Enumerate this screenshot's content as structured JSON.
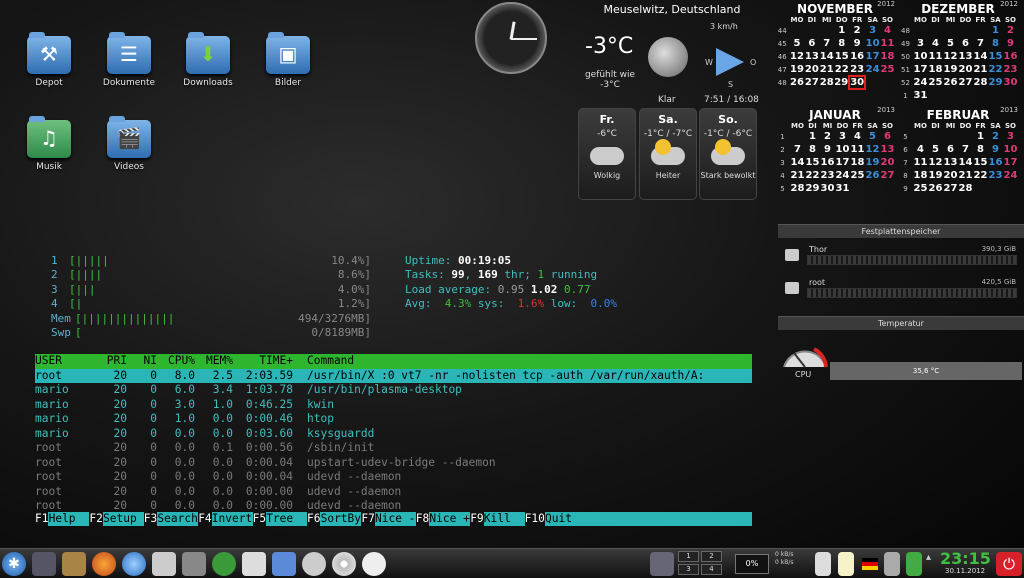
{
  "desktop": {
    "icons": [
      {
        "label": "Depot",
        "icon": "toolbox-folder-icon"
      },
      {
        "label": "Dokumente",
        "icon": "documents-folder-icon"
      },
      {
        "label": "Downloads",
        "icon": "downloads-folder-icon"
      },
      {
        "label": "Bilder",
        "icon": "pictures-folder-icon"
      },
      {
        "label": "Musik",
        "icon": "music-folder-icon"
      },
      {
        "label": "Videos",
        "icon": "videos-folder-icon"
      }
    ]
  },
  "weather": {
    "city": "Meuselwitz, Deutschland",
    "temperature": "-3°C",
    "feels_like_label": "gefühlt wie",
    "feels_like": "-3°C",
    "condition": "Klar",
    "wind_speed": "3 km/h",
    "wind_dirs": [
      "W",
      "O",
      "S"
    ],
    "sun_times": "7:51 / 16:08",
    "forecast": [
      {
        "day": "Fr.",
        "temps": "-6°C",
        "cond": "Wolkig"
      },
      {
        "day": "Sa.",
        "temps": "-1°C / -7°C",
        "cond": "Heiter"
      },
      {
        "day": "So.",
        "temps": "-1°C / -6°C",
        "cond": "Stark bewolkt"
      }
    ]
  },
  "calendars": {
    "weekday_headers": [
      "MO",
      "DI",
      "MI",
      "DO",
      "FR",
      "SA",
      "SO"
    ],
    "months": [
      {
        "name": "NOVEMBER",
        "year": "2012",
        "weeks": [
          {
            "wk": "44",
            "days": [
              "",
              "",
              "",
              "1",
              "2",
              "3",
              "4"
            ]
          },
          {
            "wk": "45",
            "days": [
              "5",
              "6",
              "7",
              "8",
              "9",
              "10",
              "11"
            ]
          },
          {
            "wk": "46",
            "days": [
              "12",
              "13",
              "14",
              "15",
              "16",
              "17",
              "18"
            ]
          },
          {
            "wk": "47",
            "days": [
              "19",
              "20",
              "21",
              "22",
              "23",
              "24",
              "25"
            ]
          },
          {
            "wk": "48",
            "days": [
              "26",
              "27",
              "28",
              "29",
              "30",
              "",
              ""
            ]
          }
        ]
      },
      {
        "name": "DEZEMBER",
        "year": "2012",
        "weeks": [
          {
            "wk": "48",
            "days": [
              "",
              "",
              "",
              "",
              "",
              "1",
              "2"
            ]
          },
          {
            "wk": "49",
            "days": [
              "3",
              "4",
              "5",
              "6",
              "7",
              "8",
              "9"
            ]
          },
          {
            "wk": "50",
            "days": [
              "10",
              "11",
              "12",
              "13",
              "14",
              "15",
              "16"
            ]
          },
          {
            "wk": "51",
            "days": [
              "17",
              "18",
              "19",
              "20",
              "21",
              "22",
              "23"
            ]
          },
          {
            "wk": "52",
            "days": [
              "24",
              "25",
              "26",
              "27",
              "28",
              "29",
              "30"
            ]
          },
          {
            "wk": "1",
            "days": [
              "31",
              "",
              "",
              "",
              "",
              "",
              ""
            ]
          }
        ]
      },
      {
        "name": "JANUAR",
        "year": "2013",
        "weeks": [
          {
            "wk": "1",
            "days": [
              "",
              "1",
              "2",
              "3",
              "4",
              "5",
              "6"
            ]
          },
          {
            "wk": "2",
            "days": [
              "7",
              "8",
              "9",
              "10",
              "11",
              "12",
              "13"
            ]
          },
          {
            "wk": "3",
            "days": [
              "14",
              "15",
              "16",
              "17",
              "18",
              "19",
              "20"
            ]
          },
          {
            "wk": "4",
            "days": [
              "21",
              "22",
              "23",
              "24",
              "25",
              "26",
              "27"
            ]
          },
          {
            "wk": "5",
            "days": [
              "28",
              "29",
              "30",
              "31",
              "",
              "",
              ""
            ]
          }
        ]
      },
      {
        "name": "FEBRUAR",
        "year": "2013",
        "weeks": [
          {
            "wk": "5",
            "days": [
              "",
              "",
              "",
              "",
              "1",
              "2",
              "3"
            ]
          },
          {
            "wk": "6",
            "days": [
              "4",
              "5",
              "6",
              "7",
              "8",
              "9",
              "10"
            ]
          },
          {
            "wk": "7",
            "days": [
              "11",
              "12",
              "13",
              "14",
              "15",
              "16",
              "17"
            ]
          },
          {
            "wk": "8",
            "days": [
              "18",
              "19",
              "20",
              "21",
              "22",
              "23",
              "24"
            ]
          },
          {
            "wk": "9",
            "days": [
              "25",
              "26",
              "27",
              "28",
              "",
              "",
              ""
            ]
          }
        ]
      }
    ],
    "today": "30"
  },
  "widgets": {
    "storage_title": "Festplattenspeicher",
    "drives": [
      {
        "name": "Thor",
        "size": "390,3 GiB"
      },
      {
        "name": "root",
        "size": "420,5 GiB"
      }
    ],
    "temp_title": "Temperatur",
    "cpu_label": "CPU",
    "cpu_temp": "35,6 °C"
  },
  "htop": {
    "meters": [
      {
        "key": "1",
        "bars": "[|||||",
        "value": "10.4%]"
      },
      {
        "key": "2",
        "bars": "[||||",
        "value": "8.6%]"
      },
      {
        "key": "3",
        "bars": "[|||",
        "value": "4.0%]"
      },
      {
        "key": "4",
        "bars": "[|",
        "value": "1.2%]"
      },
      {
        "key": "Mem",
        "bars": "[||||||||||||||",
        "value": "494/3276MB]"
      },
      {
        "key": "Swp",
        "bars": "[",
        "value": "0/8189MB]"
      }
    ],
    "uptime_label": "Uptime: ",
    "uptime": "00:19:05",
    "tasks_label": "Tasks: ",
    "tasks": "99",
    "thr": "169",
    "thr_label": " thr; ",
    "running": "1",
    "running_label": " running",
    "load_label": "Load average: ",
    "load1": "0.95",
    "load5": "1.02",
    "load15": "0.77",
    "avg_label": "Avg:",
    "avg_user": "4.3%",
    "avg_sys_label": "sys:",
    "avg_sys": "1.6%",
    "avg_low_label": "low:",
    "avg_low": "0.0%",
    "columns": [
      "USER",
      "PRI",
      "NI",
      "CPU%",
      "MEM%",
      "TIME+",
      "Command"
    ],
    "processes": [
      {
        "user": "root",
        "pri": "20",
        "ni": "0",
        "cpu": "8.0",
        "mem": "2.5",
        "time": "2:03.59",
        "cmd": "/usr/bin/X :0 vt7 -nr -nolisten tcp -auth /var/run/xauth/A:"
      },
      {
        "user": "mario",
        "pri": "20",
        "ni": "0",
        "cpu": "6.0",
        "mem": "3.4",
        "time": "1:03.78",
        "cmd": "/usr/bin/plasma-desktop"
      },
      {
        "user": "mario",
        "pri": "20",
        "ni": "0",
        "cpu": "3.0",
        "mem": "1.0",
        "time": "0:46.25",
        "cmd": "kwin"
      },
      {
        "user": "mario",
        "pri": "20",
        "ni": "0",
        "cpu": "1.0",
        "mem": "0.0",
        "time": "0:00.46",
        "cmd": "htop"
      },
      {
        "user": "mario",
        "pri": "20",
        "ni": "0",
        "cpu": "0.0",
        "mem": "0.0",
        "time": "0:03.60",
        "cmd": "ksysguardd"
      },
      {
        "user": "root",
        "pri": "20",
        "ni": "0",
        "cpu": "0.0",
        "mem": "0.1",
        "time": "0:00.56",
        "cmd": "/sbin/init"
      },
      {
        "user": "root",
        "pri": "20",
        "ni": "0",
        "cpu": "0.0",
        "mem": "0.0",
        "time": "0:00.04",
        "cmd": "upstart-udev-bridge --daemon"
      },
      {
        "user": "root",
        "pri": "20",
        "ni": "0",
        "cpu": "0.0",
        "mem": "0.0",
        "time": "0:00.04",
        "cmd": "udevd --daemon"
      },
      {
        "user": "root",
        "pri": "20",
        "ni": "0",
        "cpu": "0.0",
        "mem": "0.0",
        "time": "0:00.00",
        "cmd": "udevd --daemon"
      },
      {
        "user": "root",
        "pri": "20",
        "ni": "0",
        "cpu": "0.0",
        "mem": "0.0",
        "time": "0:00.00",
        "cmd": "udevd --daemon"
      }
    ],
    "fkeys": [
      {
        "k": "F1",
        "l": "Help"
      },
      {
        "k": "F2",
        "l": "Setup"
      },
      {
        "k": "F3",
        "l": "Search"
      },
      {
        "k": "F4",
        "l": "Invert"
      },
      {
        "k": "F5",
        "l": "Tree"
      },
      {
        "k": "F6",
        "l": "SortBy"
      },
      {
        "k": "F7",
        "l": "Nice -"
      },
      {
        "k": "F8",
        "l": "Nice +"
      },
      {
        "k": "F9",
        "l": "Kill"
      },
      {
        "k": "F10",
        "l": "Quit"
      }
    ]
  },
  "taskbar": {
    "pager": [
      "1",
      "2",
      "3",
      "4"
    ],
    "battery": "0%",
    "net_down": "0 kB/s",
    "net_up": "0 kB/s",
    "time": "23:15",
    "date": "30.11.2012"
  }
}
